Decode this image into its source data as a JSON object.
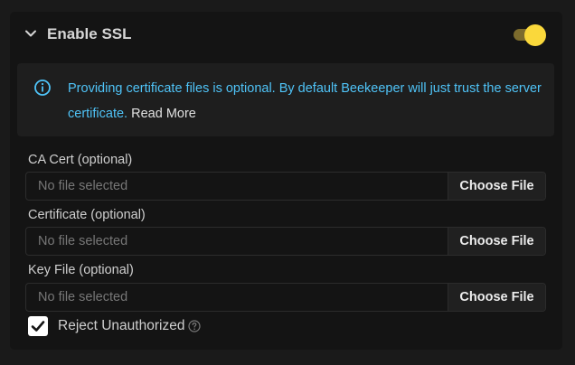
{
  "ssl": {
    "title": "Enable SSL",
    "enabled": true
  },
  "info": {
    "message": "Providing certificate files is optional. By default Beekeeper will just trust the server certificate.",
    "read_more": "Read More"
  },
  "fields": [
    {
      "label": "CA Cert (optional)",
      "value": "No file selected",
      "button": "Choose File"
    },
    {
      "label": "Certificate (optional)",
      "value": "No file selected",
      "button": "Choose File"
    },
    {
      "label": "Key File (optional)",
      "value": "No file selected",
      "button": "Choose File"
    }
  ],
  "reject": {
    "label": "Reject Unauthorized",
    "checked": true
  },
  "colors": {
    "accent": "#fad83b",
    "info_text": "#4fc3f7"
  },
  "icons": {
    "collapse": "chevron-down-icon",
    "info": "info-icon",
    "help": "help-icon",
    "check": "checkmark-icon"
  }
}
